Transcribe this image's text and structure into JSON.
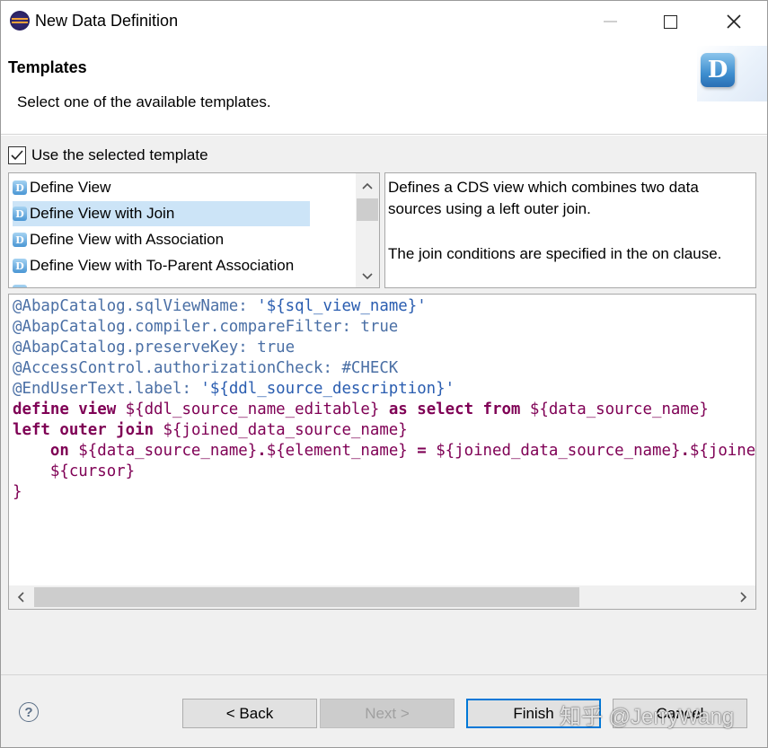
{
  "window": {
    "title": "New Data Definition"
  },
  "header": {
    "title": "Templates",
    "description": "Select one of the available templates."
  },
  "options": {
    "use_template_label": "Use the selected template",
    "use_template_checked": true
  },
  "templates": {
    "items": [
      {
        "label": "Define View"
      },
      {
        "label": "Define View with Join"
      },
      {
        "label": "Define View with Association"
      },
      {
        "label": "Define View with To-Parent Association"
      }
    ],
    "selected_index": 1
  },
  "description": {
    "para1": "Defines a CDS view which combines two data sources using a left outer join.",
    "para2": "The join conditions are specified in the on clause."
  },
  "code": {
    "lines": [
      "@AbapCatalog.sqlViewName: '${sql_view_name}'",
      "@AbapCatalog.compiler.compareFilter: true",
      "@AbapCatalog.preserveKey: true",
      "@AccessControl.authorizationCheck: #CHECK",
      "@EndUserText.label: '${ddl_source_description}'",
      "define view ${ddl_source_name_editable} as select from ${data_source_name}",
      "left outer join ${joined_data_source_name}",
      "    on ${data_source_name}.${element_name} = ${joined_data_source_name}.${joined_element_name}",
      "    ${cursor}",
      "}"
    ]
  },
  "footer": {
    "help_icon": "?",
    "back_label": "< Back",
    "next_label": "Next >",
    "finish_label": "Finish",
    "cancel_label": "Cancel",
    "watermark": "知乎 @JerryWang"
  },
  "colors": {
    "selection": "#cce4f7",
    "keyword": "#7f0055",
    "annotation": "#4a6fa5",
    "finish_border": "#0078d7"
  }
}
